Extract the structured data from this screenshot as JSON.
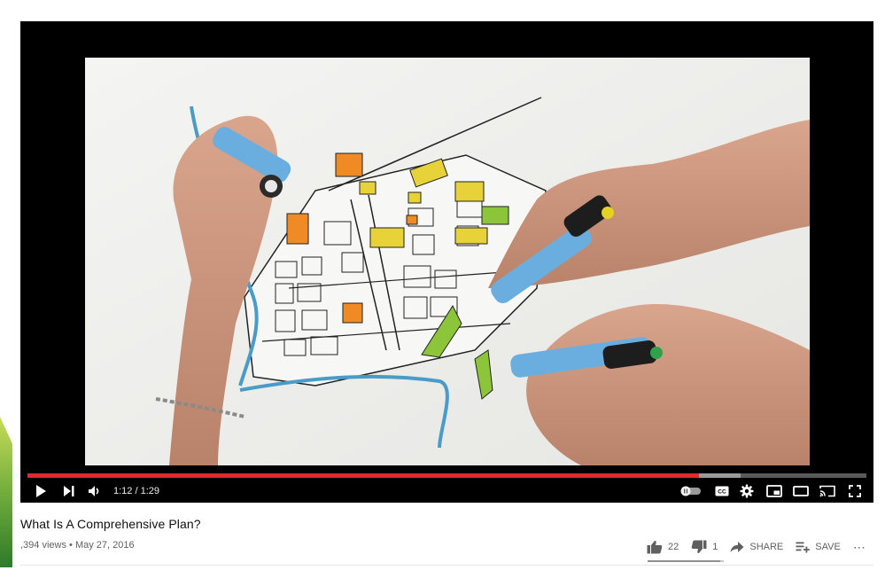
{
  "video": {
    "title": "What Is A Comprehensive Plan?",
    "views": ",394 views",
    "separator": "•",
    "date": "May 27, 2016"
  },
  "player": {
    "current_time": "1:12",
    "duration": "1:29",
    "time_display": "1:12 / 1:29",
    "progress_fraction": 0.8,
    "buffered_fraction": 0.85,
    "accent_color": "#e12b2b",
    "icons": [
      "play-icon",
      "next-icon",
      "volume-icon",
      "autoplay-toggle-icon",
      "captions-icon",
      "settings-icon",
      "miniplayer-icon",
      "theater-icon",
      "cast-icon",
      "fullscreen-icon"
    ]
  },
  "actions": {
    "likes": "22",
    "dislikes": "1",
    "share": "SHARE",
    "save": "SAVE",
    "more": "⋯",
    "like_ratio": 0.957
  }
}
